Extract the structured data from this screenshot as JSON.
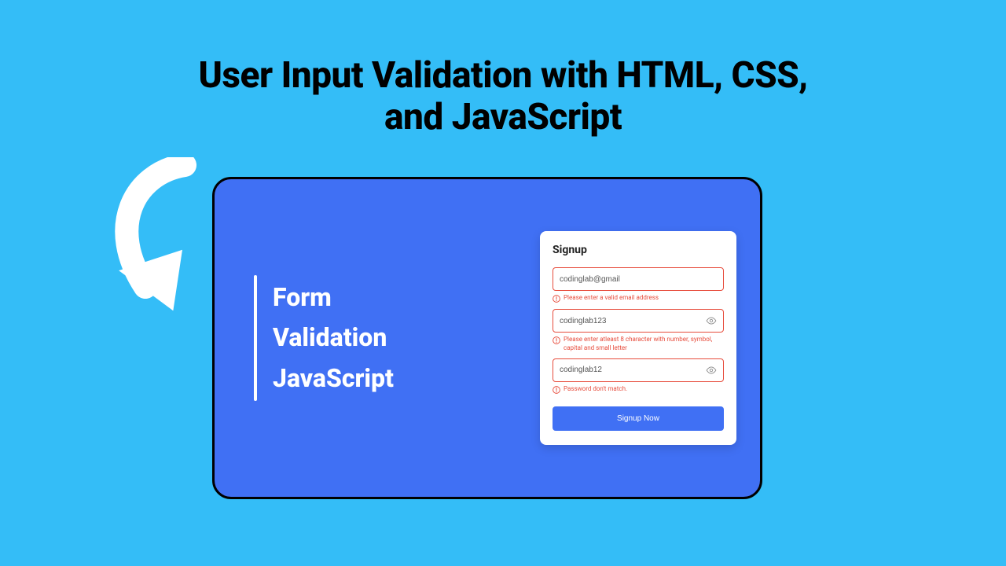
{
  "headline": "User Input Validation with HTML, CSS, and JavaScript",
  "panel": {
    "line1": "Form",
    "line2": "Validation",
    "line3": "JavaScript"
  },
  "form": {
    "title": "Signup",
    "email": {
      "value": "codinglab@gmail",
      "error": "Please enter a valid email address"
    },
    "password": {
      "value": "codinglab123",
      "error": "Please enter atleast 8 character with number, symbol, capital and small letter"
    },
    "confirm": {
      "value": "codinglab12",
      "error": "Password don't match."
    },
    "submit_label": "Signup Now"
  },
  "colors": {
    "page_bg": "#34bdf7",
    "card_bg": "#4070f4",
    "error": "#e74c3c"
  }
}
